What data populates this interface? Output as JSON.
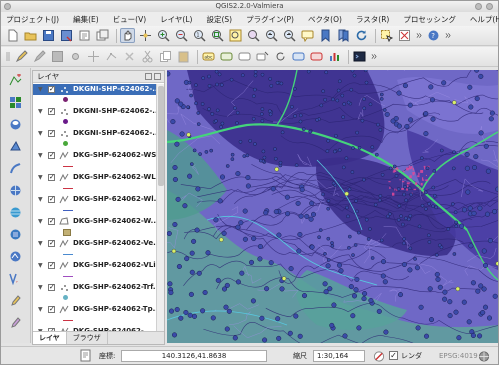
{
  "window": {
    "title": "QGIS2.2.0-Valmiera"
  },
  "menubar": {
    "items": [
      "プロジェクト(J)",
      "編集(E)",
      "ビュー(V)",
      "レイヤ(L)",
      "設定(S)",
      "プラグイン(P)",
      "ベクタ(O)",
      "ラスタ(R)",
      "プロセッシング",
      "ヘルプ(H)"
    ]
  },
  "layers_panel": {
    "title": "レイヤ",
    "layers": [
      {
        "name": "DKGNI-SHP-624062-...",
        "geom": "point",
        "legend": "dot",
        "color": "#7a2070",
        "selected": true
      },
      {
        "name": "DKGNI-SHP-624062-...",
        "geom": "point",
        "legend": "dot",
        "color": "#6a1a8a",
        "selected": false
      },
      {
        "name": "DKGNI-SHP-624062-...",
        "geom": "point",
        "legend": "dot",
        "color": "#49a83a",
        "selected": false
      },
      {
        "name": "DKG-SHP-624062-WS...",
        "geom": "line",
        "legend": "line",
        "color": "#cc3344",
        "selected": false
      },
      {
        "name": "DKG-SHP-624062-WL...",
        "geom": "line",
        "legend": "line",
        "color": "#cc3344",
        "selected": false
      },
      {
        "name": "DKG-SHP-624062-Wl...",
        "geom": "line",
        "legend": "line",
        "color": "#4060c0",
        "selected": false
      },
      {
        "name": "DKG-SHP-624062-W...",
        "geom": "polygon",
        "legend": "square",
        "color": "#c2b074",
        "selected": false
      },
      {
        "name": "DKG-SHP-624062-Ve...",
        "geom": "line",
        "legend": "line",
        "color": "#4a8ad0",
        "selected": false
      },
      {
        "name": "DKG-SHP-624062-VLi...",
        "geom": "line",
        "legend": "line",
        "color": "#a04ec0",
        "selected": false
      },
      {
        "name": "DKG-SHP-624062-Trf...",
        "geom": "point",
        "legend": "dot",
        "color": "#66b2c4",
        "selected": false
      },
      {
        "name": "DKG-SHP-624062-Tp...",
        "geom": "line",
        "legend": "line",
        "color": "#cc3344",
        "selected": false
      },
      {
        "name": "DKG-SHP-624062-...",
        "geom": "line",
        "legend": "line",
        "color": "#888888",
        "selected": false
      }
    ],
    "tabs": [
      "レイヤ",
      "ブラウザ"
    ]
  },
  "statusbar": {
    "coord_label": "座標:",
    "coord_value": "140.3126,41.8638",
    "scale_label": "縮尺",
    "scale_value": "1:30,164",
    "render_label": "レンダ",
    "crs": "EPSG:4019"
  },
  "icons": {
    "left_toolbar": [
      "add-vector-icon",
      "add-raster-icon",
      "add-postgis-icon",
      "add-spatialite-icon",
      "add-mssql-icon",
      "add-oracle-icon",
      "add-wms-icon",
      "add-wcs-icon",
      "add-wfs-icon",
      "add-delimited-icon",
      "new-shapefile-icon",
      "new-spatialite-icon"
    ]
  },
  "colors": {
    "map_background": "#6f68c6",
    "selection": "#3b6eb7",
    "river": "#4fd27a",
    "contour": "#2f2a7a",
    "point_fill": "#3a4aa8"
  }
}
